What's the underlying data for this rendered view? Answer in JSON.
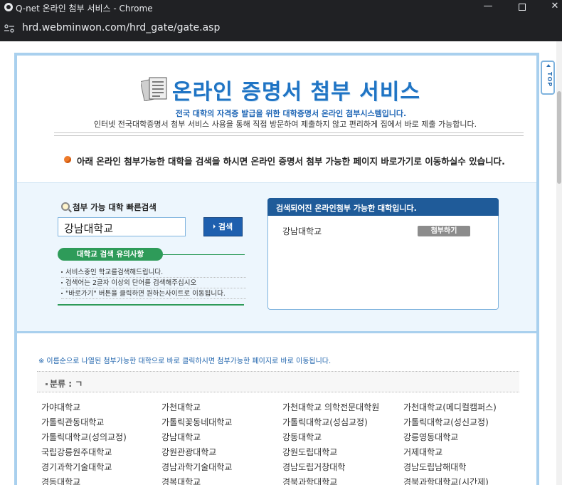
{
  "window": {
    "title": "Q-net 온라인 첨부 서비스 - Chrome",
    "minimize": "—",
    "close": "✕"
  },
  "address": {
    "url": "hrd.webminwon.com/hrd_gate/gate.asp"
  },
  "side_tab": {
    "label": "TOP"
  },
  "header": {
    "title": "온라인 증명서 첨부 서비스",
    "subtitle": "전국 대학의 자격증 발급을 위한 대학증명서 온라인 첨부시스템입니다.",
    "description": "인터넷 전국대학증명서 첨부 서비스 사용을 통해 직접 방문하여 제출하지 않고 편리하게 집에서 바로 제출 가능합니다.",
    "notice": "아래 온라인 첨부가능한 대학을 검색을 하시면 온라인 증명서 첨부 가능한 페이지 바로가기로 이동하실수 있습니다."
  },
  "search": {
    "title": "첨부 가능 대학 빠른검색",
    "input_value": "강남대학교",
    "button": "검색",
    "caution_title": "대학교 검색 유의사항",
    "caution_items": [
      "서비스중인 학교를검색해드립니다.",
      "검색어는 2글자 이상의 단어를 검색해주십시오",
      "\"바로가기\" 버튼을 클릭하면 원하는사이트로 이동됩니다."
    ]
  },
  "result": {
    "title": "검색되어진 온라인첨부 가능한 대학입니다.",
    "name": "강남대학교",
    "attach_button": "첨부하기"
  },
  "list": {
    "note_mark": "※",
    "note": "이름순으로 나열된 첨부가능한 대학으로 바로 클릭하시면 첨부가능한 페이지로 바로 이동됩니다.",
    "category_label": "분류 : ㄱ",
    "universities": [
      "가야대학교",
      "가천대학교",
      "가천대학교 의학전문대학원",
      "가천대학교(메디컬캠퍼스)",
      "가톨릭관동대학교",
      "가톨릭꽃동네대학교",
      "가톨릭대학교(성심교정)",
      "가톨릭대학교(성신교정)",
      "가톨릭대학교(성의교정)",
      "강남대학교",
      "강동대학교",
      "강릉영동대학교",
      "국립강릉원주대학교",
      "강원관광대학교",
      "강원도립대학교",
      "거제대학교",
      "경기과학기술대학교",
      "경남과학기술대학교",
      "경남도립거창대학",
      "경남도립남해대학",
      "경동대학교",
      "경복대학교",
      "경북과학대학교",
      "경북과학대학교(시간제)"
    ]
  }
}
